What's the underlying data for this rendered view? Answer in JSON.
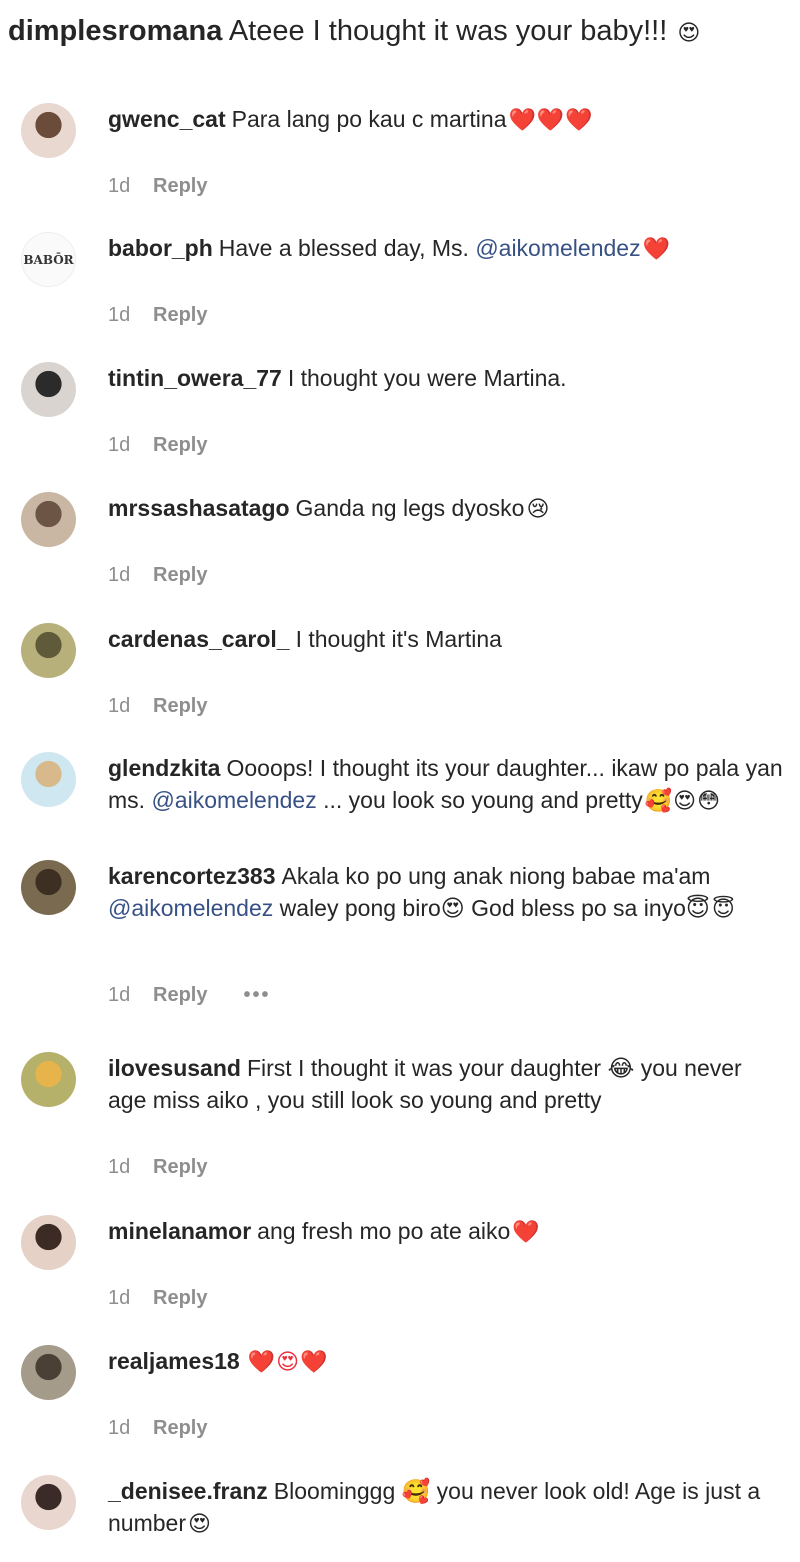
{
  "top_comment": {
    "username": "dimplesromana",
    "text": "Ateee I thought it was your baby!!!",
    "emoji": "😍"
  },
  "comments": [
    {
      "username": "gwenc_cat",
      "parts": [
        "Para lang po kau c martina"
      ],
      "emoji": "❤️❤️❤️",
      "time": "1d",
      "reply": "Reply",
      "avatar": "avatar-photo"
    },
    {
      "username": "babor_ph",
      "parts": [
        "Have a blessed day, Ms. ",
        "@aikomelendez"
      ],
      "emoji": "❤️",
      "time": "1d",
      "reply": "Reply",
      "avatar": "babor-logo",
      "logo_text": "BABŌR"
    },
    {
      "username": "tintin_owera_77",
      "parts": [
        "I thought you were Martina."
      ],
      "emoji": "",
      "time": "1d",
      "reply": "Reply",
      "avatar": "avatar-photo"
    },
    {
      "username": "mrssashasatago",
      "parts": [
        "Ganda ng legs dyosko"
      ],
      "emoji": "😢",
      "time": "1d",
      "reply": "Reply",
      "avatar": "avatar-photo"
    },
    {
      "username": "cardenas_carol_",
      "parts": [
        "I thought it's Martina"
      ],
      "emoji": "",
      "time": "1d",
      "reply": "Reply",
      "avatar": "avatar-photo"
    },
    {
      "username": "glendzkita",
      "parts": [
        "Oooops! I thought its your daughter... ikaw po pala yan ms. ",
        "@aikomelendez",
        " ... you look so young and pretty"
      ],
      "emoji": "🥰😍😳",
      "time": "",
      "reply": "",
      "avatar": "avatar-photo"
    },
    {
      "username": "karencortez383",
      "parts": [
        "Akala ko po ung anak niong babae ma'am ",
        "@aikomelendez",
        " waley pong biro😍 God bless po sa inyo😇"
      ],
      "emoji": "😇",
      "time": "1d",
      "reply": "Reply",
      "more": "•••",
      "avatar": "avatar-photo"
    },
    {
      "username": "ilovesusand",
      "parts": [
        "First I thought it was your daughter 😂 you never age miss aiko , you still look so young and pretty"
      ],
      "emoji": "",
      "time": "1d",
      "reply": "Reply",
      "avatar": "avatar-photo"
    },
    {
      "username": "minelanamor",
      "parts": [
        "ang fresh mo po ate aiko"
      ],
      "emoji": "❤️",
      "time": "1d",
      "reply": "Reply",
      "avatar": "avatar-photo"
    },
    {
      "username": "realjames18",
      "parts": [
        ""
      ],
      "emoji": "❤️😍❤️",
      "time": "1d",
      "reply": "Reply",
      "avatar": "avatar-photo"
    },
    {
      "username": "_denisee.franz",
      "parts": [
        "Bloominggg 🥰 you never look old! Age is just a number"
      ],
      "emoji": "😍",
      "time": "",
      "reply": "",
      "avatar": "avatar-photo"
    }
  ],
  "colors": {
    "text": "#262626",
    "muted": "#8e8e8e",
    "mention": "#385185",
    "heart": "#ed2e3c"
  }
}
